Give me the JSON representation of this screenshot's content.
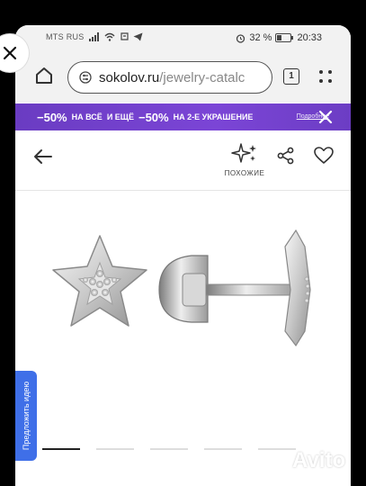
{
  "status_bar": {
    "carrier": "MTS RUS",
    "battery": "32 %",
    "time": "20:33"
  },
  "browser": {
    "url_domain": "sokolov.ru",
    "url_path": "/jewelry-catalc",
    "tab_count": "1"
  },
  "promo_banner": {
    "discount_1": "−50%",
    "text_1": "НА ВСЁ",
    "connector": "И ЕЩЁ",
    "discount_2": "−50%",
    "text_2": "НА 2-Е УКРАШЕНИЕ",
    "more_link": "Подробнее"
  },
  "product_toolbar": {
    "similar_label": "ПОХОЖИЕ"
  },
  "product": {
    "suggest_idea_label": "Предложить идею",
    "image_count": 5,
    "active_image": 0
  },
  "watermark": {
    "text": "Avito"
  },
  "colors": {
    "banner": "#7040cc",
    "suggest_tab": "#3f6fe8"
  }
}
